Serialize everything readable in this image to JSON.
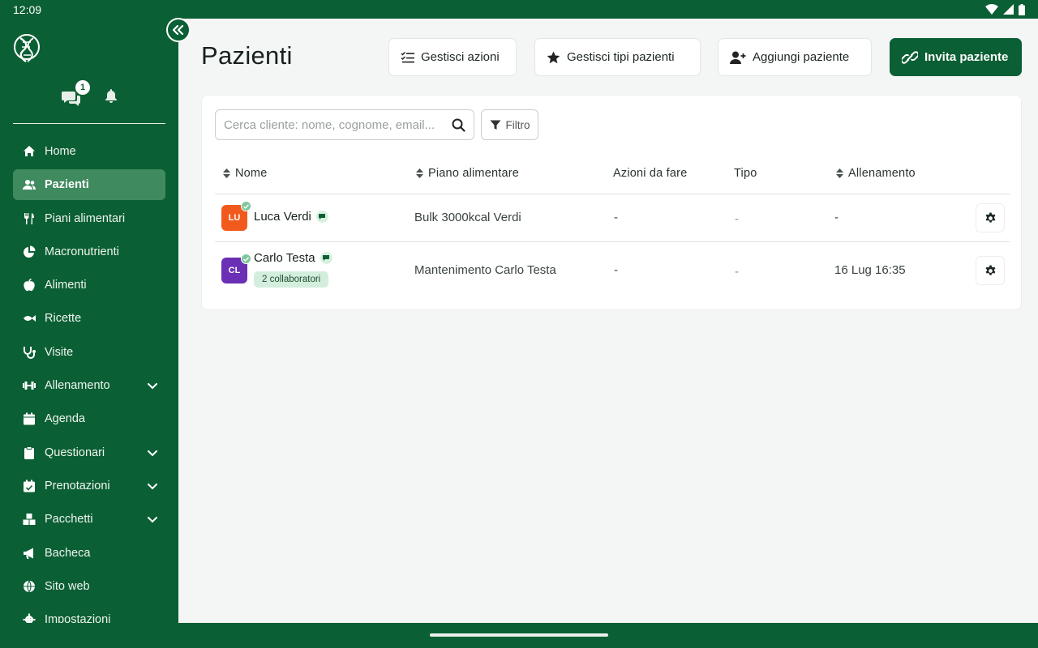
{
  "status": {
    "time": "12:09"
  },
  "sidebar": {
    "unread_messages": "1",
    "items": [
      {
        "label": "Home",
        "icon": "home-icon",
        "active": false,
        "expandable": false
      },
      {
        "label": "Pazienti",
        "icon": "users-icon",
        "active": true,
        "expandable": false
      },
      {
        "label": "Piani alimentari",
        "icon": "utensils-icon",
        "active": false,
        "expandable": false
      },
      {
        "label": "Macronutrienti",
        "icon": "pie-chart-icon",
        "active": false,
        "expandable": false
      },
      {
        "label": "Alimenti",
        "icon": "apple-icon",
        "active": false,
        "expandable": false
      },
      {
        "label": "Ricette",
        "icon": "fish-icon",
        "active": false,
        "expandable": false
      },
      {
        "label": "Visite",
        "icon": "stethoscope-icon",
        "active": false,
        "expandable": false
      },
      {
        "label": "Allenamento",
        "icon": "dumbbell-icon",
        "active": false,
        "expandable": true
      },
      {
        "label": "Agenda",
        "icon": "calendar-icon",
        "active": false,
        "expandable": false
      },
      {
        "label": "Questionari",
        "icon": "clipboard-icon",
        "active": false,
        "expandable": true
      },
      {
        "label": "Prenotazioni",
        "icon": "calendar-check-icon",
        "active": false,
        "expandable": true
      },
      {
        "label": "Pacchetti",
        "icon": "boxes-icon",
        "active": false,
        "expandable": true
      },
      {
        "label": "Bacheca",
        "icon": "megaphone-icon",
        "active": false,
        "expandable": false
      },
      {
        "label": "Sito web",
        "icon": "globe-icon",
        "active": false,
        "expandable": false
      },
      {
        "label": "Impostazioni",
        "icon": "gear-icon",
        "active": false,
        "expandable": false
      }
    ]
  },
  "header": {
    "title": "Pazienti",
    "manage_actions": "Gestisci azioni",
    "manage_types": "Gestisci tipi pazienti",
    "add_patient": "Aggiungi paziente",
    "invite_patient": "Invita paziente"
  },
  "search": {
    "placeholder": "Cerca cliente: nome, cognome, email...",
    "value": ""
  },
  "filter": {
    "label": "Filtro"
  },
  "table": {
    "columns": [
      "Nome",
      "Piano alimentare",
      "Azioni da fare",
      "Tipo",
      "Allenamento"
    ],
    "rows": [
      {
        "initials": "LU",
        "avatar_color": "#f25a1d",
        "name": "Luca Verdi",
        "collaborators": "",
        "plan": "Bulk 3000kcal Verdi",
        "actions": "-",
        "type": "-",
        "training": "-"
      },
      {
        "initials": "CL",
        "avatar_color": "#6a2fb4",
        "name": "Carlo Testa",
        "collaborators": "2 collaboratori",
        "plan": "Mantenimento Carlo Testa",
        "actions": "-",
        "type": "-",
        "training": "16 Lug 16:35"
      }
    ]
  },
  "colors": {
    "brand": "#0b5f34",
    "active_nav": "#3f8a5e",
    "background": "#f4f6f5"
  }
}
